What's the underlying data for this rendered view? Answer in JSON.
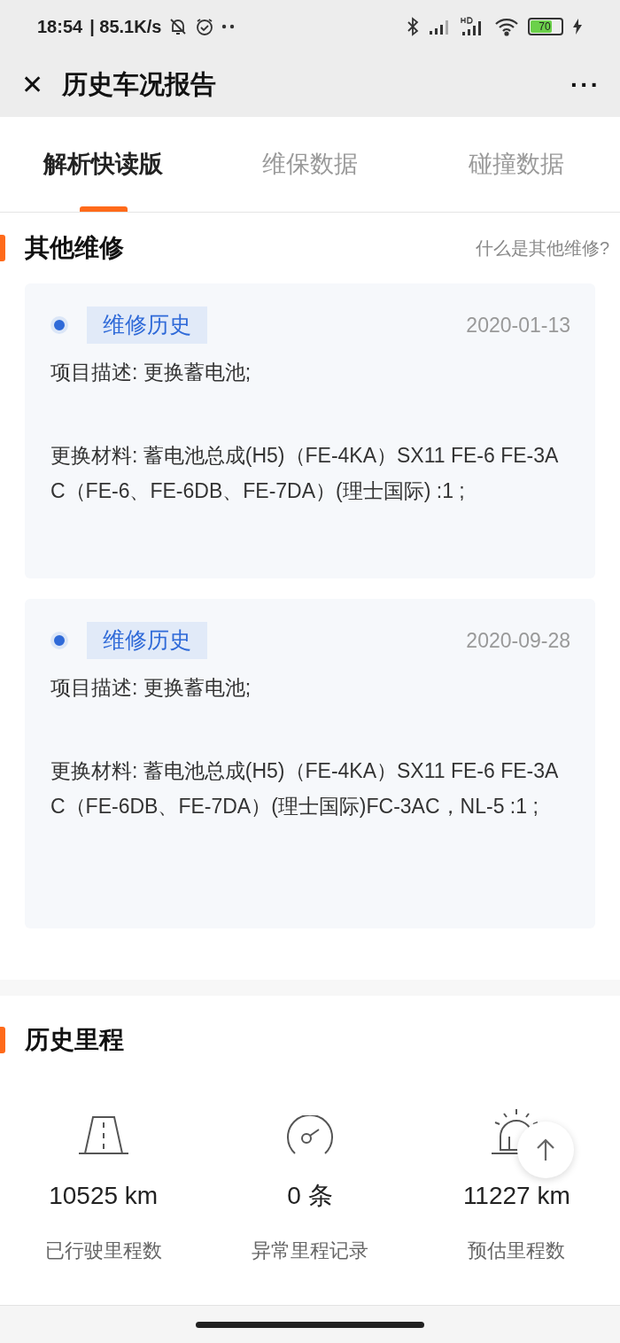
{
  "status_bar": {
    "time": "18:54",
    "speed": "| 85.1K/s",
    "battery": "70"
  },
  "title_bar": {
    "close": "✕",
    "title": "历史车况报告",
    "more": "···"
  },
  "tabs": [
    {
      "label": "解析快读版",
      "selected": true
    },
    {
      "label": "维保数据",
      "selected": false
    },
    {
      "label": "碰撞数据",
      "selected": false
    }
  ],
  "other_repairs": {
    "title": "其他维修",
    "help_link": "什么是其他维修?",
    "records": [
      {
        "tag": "维修历史",
        "date": "2020-01-13",
        "description": "项目描述: 更换蓄电池;",
        "materials": "更换材料: 蓄电池总成(H5)（FE-4KA）SX11 FE-6 FE-3AC（FE-6、FE-6DB、FE-7DA）(理士国际) :1 ;"
      },
      {
        "tag": "维修历史",
        "date": "2020-09-28",
        "description": "项目描述: 更换蓄电池;",
        "materials": "更换材料: 蓄电池总成(H5)（FE-4KA）SX11 FE-6 FE-3AC（FE-6DB、FE-7DA）(理士国际)FC-3AC，NL-5 :1 ;"
      }
    ]
  },
  "mileage": {
    "title": "历史里程",
    "stats": [
      {
        "kind": "road",
        "value": "10525 km",
        "label": "已行驶里程数"
      },
      {
        "kind": "gauge",
        "value": "0 条",
        "label": "异常里程记录"
      },
      {
        "kind": "beacon",
        "value": "11227 km",
        "label": "预估里程数"
      }
    ]
  }
}
